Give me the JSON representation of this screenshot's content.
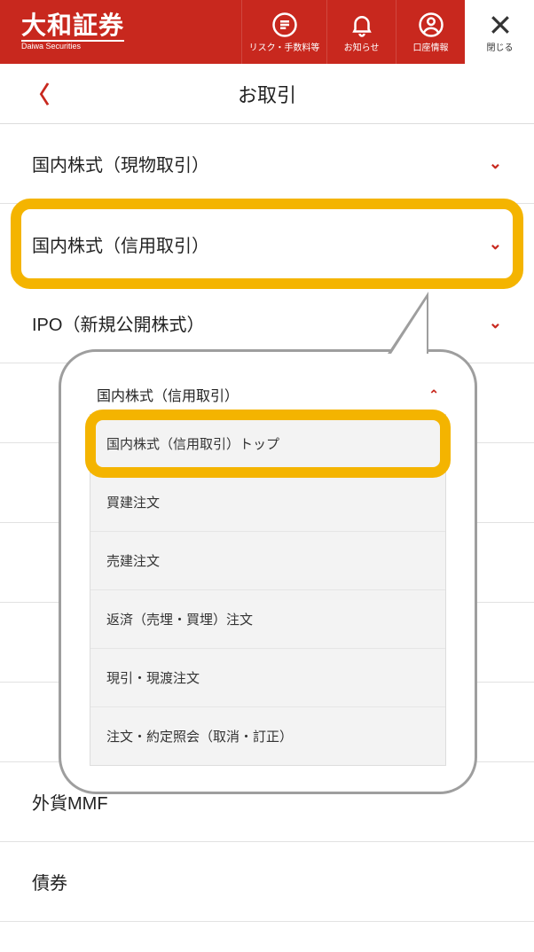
{
  "header": {
    "logo_main": "大和証券",
    "logo_sub": "Daiwa Securities",
    "risk_label": "リスク・手数料等",
    "notice_label": "お知らせ",
    "account_label": "口座情報",
    "close_label": "閉じる"
  },
  "title": "お取引",
  "rows": {
    "cash": "国内株式（現物取引）",
    "margin": "国内株式（信用取引）",
    "ipo": "IPO（新規公開株式）",
    "fmmf": "外貨MMF",
    "bond": "債券"
  },
  "callout": {
    "head": "国内株式（信用取引）",
    "items": [
      "国内株式（信用取引）トップ",
      "買建注文",
      "売建注文",
      "返済（売埋・買埋）注文",
      "現引・現渡注文",
      "注文・約定照会（取消・訂正）"
    ]
  }
}
